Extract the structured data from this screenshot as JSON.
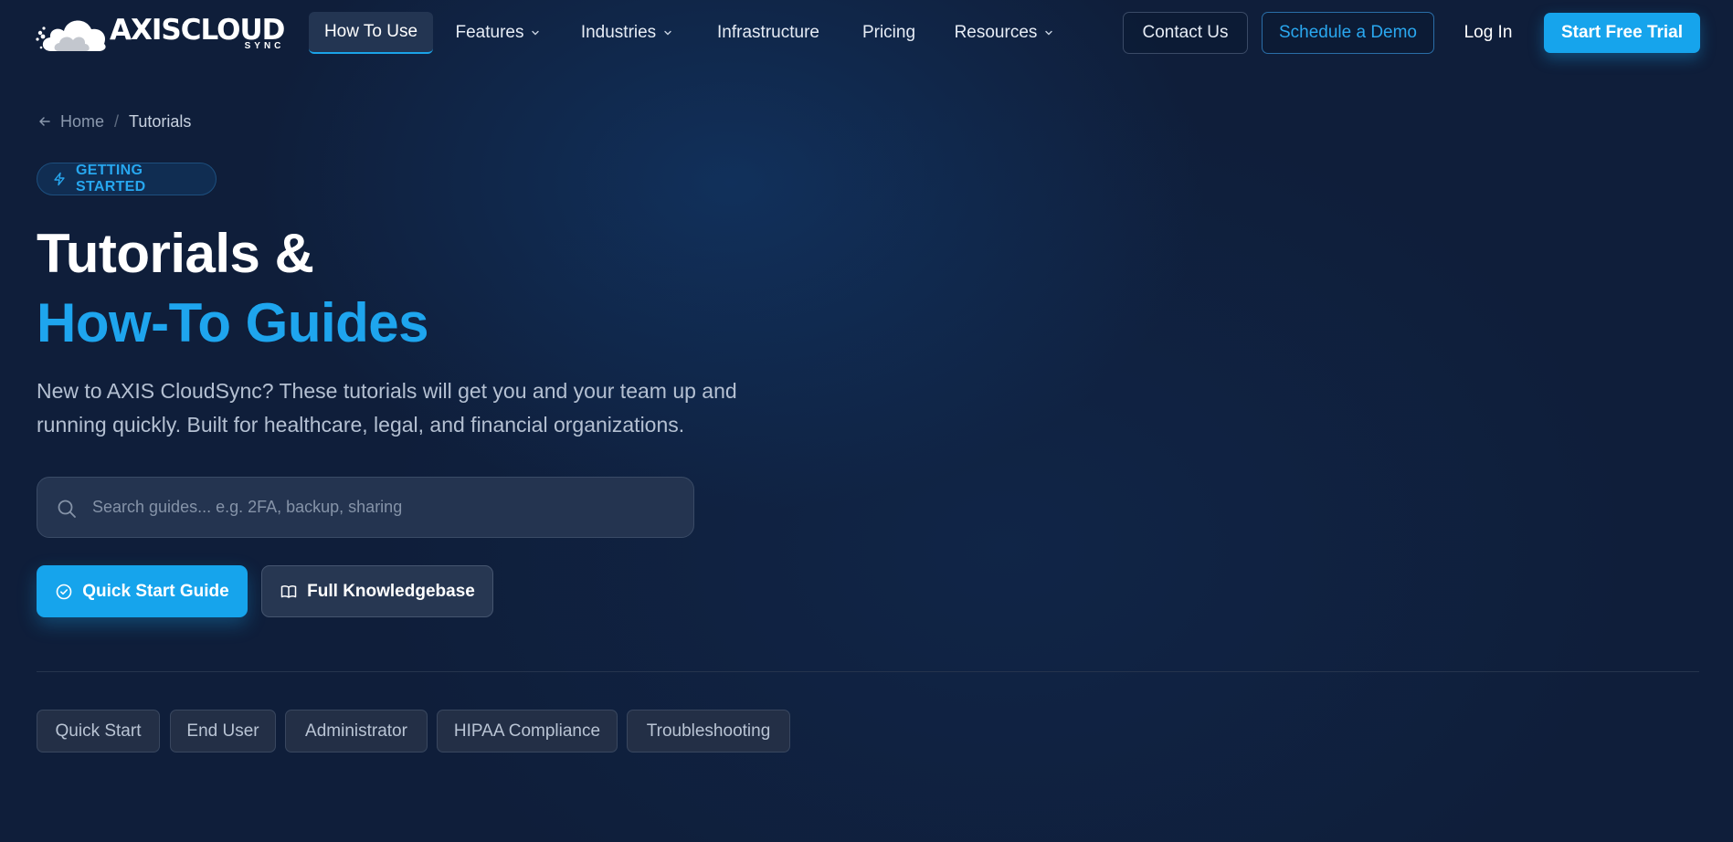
{
  "brand": {
    "name": "AXISCLOUD",
    "sub": "SYNC"
  },
  "nav": {
    "links": [
      {
        "label": "How To Use",
        "active": true
      },
      {
        "label": "Features",
        "dropdown": true
      },
      {
        "label": "Industries",
        "dropdown": true
      },
      {
        "label": "Infrastructure"
      },
      {
        "label": "Pricing"
      },
      {
        "label": "Resources",
        "dropdown": true
      }
    ],
    "contact": "Contact Us",
    "demo": "Schedule a Demo",
    "login": "Log In",
    "trial": "Start Free Trial"
  },
  "breadcrumb": {
    "home": "Home",
    "separator": "/",
    "current": "Tutorials"
  },
  "badge": "GETTING STARTED",
  "hero": {
    "title_line1": "Tutorials &",
    "title_line2": "How-To Guides",
    "subtitle": "New to AXIS CloudSync? These tutorials will get you and your team up and running quickly. Built for healthcare, legal, and financial organizations."
  },
  "search": {
    "placeholder": "Search guides... e.g. 2FA, backup, sharing",
    "value": ""
  },
  "cta": {
    "primary": "Quick Start Guide",
    "secondary": "Full Knowledgebase"
  },
  "chips": [
    "Quick Start",
    "End User",
    "Administrator",
    "HIPAA Compliance",
    "Troubleshooting"
  ],
  "colors": {
    "background": "#0f1e3a",
    "accent": "#16a4ec",
    "accent_text": "#1ea5ee",
    "muted_text": "#b4c0d2"
  }
}
